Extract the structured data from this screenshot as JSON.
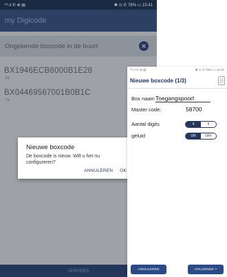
{
  "phone1": {
    "status": {
      "left": "⁴ᴳ.ıl ✆ ⊗ ▤",
      "right": "✱ ⊙ ✆ 78% ▭ 15:41"
    },
    "app_title": "my Digicode",
    "banner_text": "Ongekende boxcode in de buurt",
    "list": [
      {
        "name": "BX1946ECB6000B1E28",
        "sub": "-65"
      },
      {
        "name": "BX04469567001B0B1C",
        "sub": "-73"
      }
    ],
    "bottom_label": "VERVERS"
  },
  "dialog": {
    "title": "Nieuwe boxcode",
    "message": "De boxcode is nieuw. Wilt u het nu configureren?",
    "cancel_label": "ANNULEREN",
    "ok_label": "OK"
  },
  "phone2": {
    "status": {
      "left": "⁴ᴳ.ıl ✆ ⊗ ▤",
      "right": "✱ ⊙ ✆ 76% ▭ 15:42"
    },
    "header_title": "Nieuwe boxcode (1/3)",
    "box_name_label": "Box naam",
    "box_name_value": "Toegangspoort",
    "master_code_label": "Master code:",
    "master_code_value": "58700",
    "digits_label": "Aantal digits",
    "digits_options": [
      "4",
      "5"
    ],
    "digits_selected": "4",
    "sound_label": "geluid",
    "sound_options": [
      "ON",
      "OFF"
    ],
    "sound_selected": "ON",
    "cancel_label": "ANNULEREN",
    "next_label": "VOLGENDE >"
  }
}
